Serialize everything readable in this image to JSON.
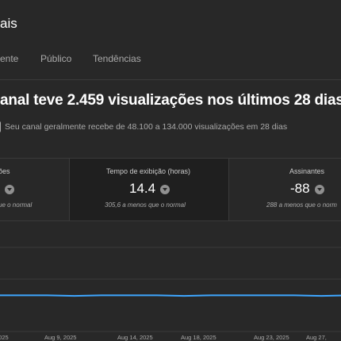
{
  "header": {
    "title": "ais"
  },
  "tabs": [
    {
      "label": "ente"
    },
    {
      "label": "Público"
    },
    {
      "label": "Tendências"
    }
  ],
  "summary": {
    "headline": "anal teve 2.459 visualizações nos últimos 28 dias",
    "subheadline": "Seu canal geralmente recebe de 48.100 a 134.000 visualizações em 28 dias"
  },
  "cards": {
    "views": {
      "title": "ões",
      "value": "",
      "note": "ue o normal"
    },
    "watch": {
      "title": "Tempo de exibição (horas)",
      "value": "14.4",
      "note": "305,6 a menos que o normal"
    },
    "subs": {
      "title": "Assinantes",
      "value": "-88",
      "note": "288 a menos que o norm"
    }
  },
  "icons": {
    "trend": "arrow-down-circle-icon",
    "info": "info-icon"
  },
  "colors": {
    "background": "#282828",
    "highlight_card": "#1f1f1f",
    "series": "#3ea6ff"
  },
  "chart_data": {
    "type": "line",
    "x": [
      "2025-08-03",
      "2025-08-05",
      "2025-08-07",
      "2025-08-09",
      "2025-08-11",
      "2025-08-13",
      "2025-08-15",
      "2025-08-17",
      "2025-08-19",
      "2025-08-21",
      "2025-08-23",
      "2025-08-25",
      "2025-08-27",
      "2025-08-29"
    ],
    "series": [
      {
        "values": [
          88,
          88,
          88,
          87,
          88,
          88,
          88,
          87,
          88,
          88,
          88,
          88,
          87,
          88
        ]
      }
    ],
    "x_tick_labels": [
      "2025",
      "Aug 9, 2025",
      "Aug 14, 2025",
      "Aug 18, 2025",
      "Aug 23, 2025",
      "Aug 27,"
    ],
    "grid": true
  }
}
